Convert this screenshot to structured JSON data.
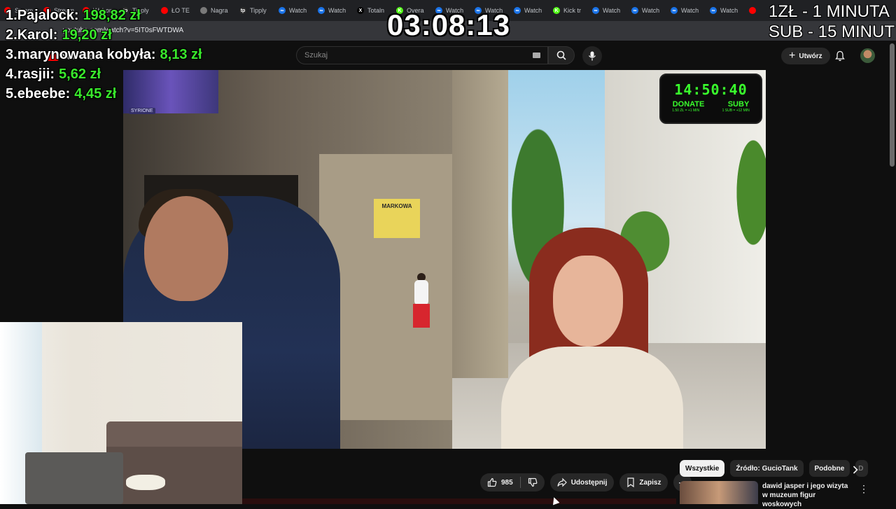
{
  "browser": {
    "tabs": [
      {
        "label": "Steam",
        "color": "#ff0000",
        "glyph": ""
      },
      {
        "label": "Stream",
        "color": "#ff0000",
        "glyph": ""
      },
      {
        "label": "Wybory",
        "color": "#ff0000",
        "glyph": ""
      },
      {
        "label": "Tipply",
        "color": "#2a2a2a",
        "glyph": "tp"
      },
      {
        "label": "ŁO TE",
        "color": "#ff0000",
        "glyph": ""
      },
      {
        "label": "Nagra",
        "color": "#7a7a7a",
        "glyph": ""
      },
      {
        "label": "Tipply",
        "color": "#2a2a2a",
        "glyph": "tp"
      },
      {
        "label": "Watch",
        "color": "#1a73e8",
        "glyph": "∞"
      },
      {
        "label": "Watch",
        "color": "#1a73e8",
        "glyph": "∞"
      },
      {
        "label": "Totaln",
        "color": "#000000",
        "glyph": "X"
      },
      {
        "label": "Overa",
        "color": "#53fc18",
        "glyph": "K"
      },
      {
        "label": "Watch",
        "color": "#1a73e8",
        "glyph": "∞"
      },
      {
        "label": "Watch",
        "color": "#1a73e8",
        "glyph": "∞"
      },
      {
        "label": "Watch",
        "color": "#1a73e8",
        "glyph": "∞"
      },
      {
        "label": "Kick tr",
        "color": "#53fc18",
        "glyph": "K"
      },
      {
        "label": "Watch",
        "color": "#1a73e8",
        "glyph": "∞"
      },
      {
        "label": "Watch",
        "color": "#1a73e8",
        "glyph": "∞"
      },
      {
        "label": "Watch",
        "color": "#1a73e8",
        "glyph": "∞"
      },
      {
        "label": "Watch",
        "color": "#1a73e8",
        "glyph": "∞"
      },
      {
        "label": "",
        "color": "#ff0000",
        "glyph": ""
      }
    ],
    "url": "youtube.com/watch?v=5IT0sFWTDWA"
  },
  "youtube": {
    "logo_text": "YouTube",
    "search_placeholder": "Szukaj",
    "create_label": "Utwórz"
  },
  "overlay": {
    "leaderboard": [
      {
        "rank": "1.",
        "name": "Pajalock:",
        "amount": "198,82 zł"
      },
      {
        "rank": "2.",
        "name": "Karol:",
        "amount": "19,20 zł"
      },
      {
        "rank": "3.",
        "name": "marynowana kobyła:",
        "amount": "8,13 zł"
      },
      {
        "rank": "4.",
        "name": "rasjii:",
        "amount": "5,62 zł"
      },
      {
        "rank": "5.",
        "name": "ebeebe:",
        "amount": "4,45 zł"
      }
    ],
    "stream_timer": "03:08:13",
    "rules": [
      "1ZŁ - 1 MINUTA",
      "SUB - 15 MINUT"
    ]
  },
  "video_overlay": {
    "timer": "14:50:40",
    "donate_label": "DONATE",
    "suby_label": "SUBY",
    "donate_rate": "1.50 ZŁ = +1 MIN",
    "suby_rate": "1 SUB = +12 MIN",
    "channel_badge": "SYRIONE",
    "shop_sign": "MARKOWA"
  },
  "actions": {
    "likes": "985",
    "share_label": "Udostępnij",
    "save_label": "Zapisz"
  },
  "chips": [
    {
      "label": "Wszystkie",
      "active": true
    },
    {
      "label": "Źródło: GucioTank",
      "active": false
    },
    {
      "label": "Podobne",
      "active": false
    },
    {
      "label": "D",
      "active": false
    }
  ],
  "recommendation": {
    "title": "dawid jasper i jego wizyta w muzeum figur woskowych"
  },
  "progress": {
    "fraction": 0.0
  }
}
